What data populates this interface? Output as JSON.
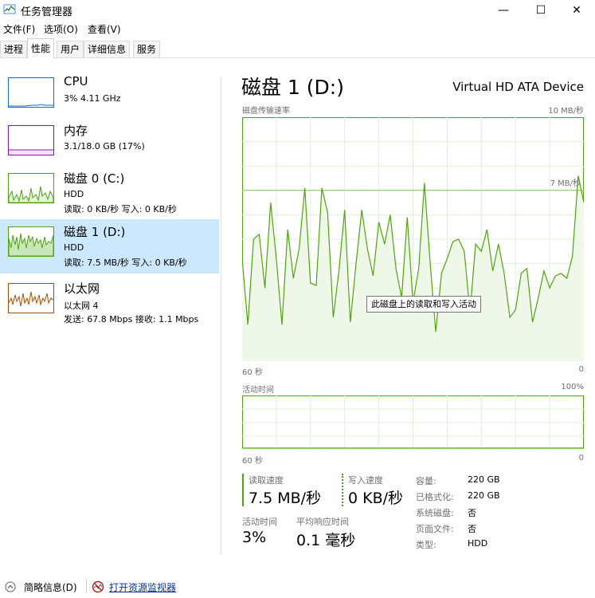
{
  "window": {
    "title": "任务管理器",
    "min_glyph": "—",
    "max_glyph": "☐",
    "close_glyph": "✕"
  },
  "menu": [
    "文件(F)",
    "选项(O)",
    "查看(V)"
  ],
  "tabs": [
    "进程",
    "性能",
    "用户",
    "详细信息",
    "服务"
  ],
  "active_tab": 1,
  "sidebar": [
    {
      "title": "CPU",
      "line2": "3% 4.11 GHz",
      "line3": "",
      "color": "#1171b8"
    },
    {
      "title": "内存",
      "line2": "3.1/18.0 GB (17%)",
      "line3": "",
      "color": "#8b12ae"
    },
    {
      "title": "磁盘 0 (C:)",
      "line2": "HDD",
      "line3": "读取: 0 KB/秒 写入: 0 KB/秒",
      "color": "#4da60c"
    },
    {
      "title": "磁盘 1 (D:)",
      "line2": "HDD",
      "line3": "读取: 7.5 MB/秒 写入: 0 KB/秒",
      "color": "#4da60c"
    },
    {
      "title": "以太网",
      "line2": "以太网 4",
      "line3": "发送: 67.8 Mbps 接收: 1.1 Mbps",
      "color": "#a74f01"
    }
  ],
  "active_sidebar": 3,
  "main": {
    "title": "磁盘 1 (D:)",
    "device": "Virtual HD ATA Device",
    "transfer_label": "磁盘传输速率",
    "transfer_max": "10 MB/秒",
    "transfer_mid": "7 MB/秒",
    "time_left": "60 秒",
    "time_right": "0",
    "active_label": "活动时间",
    "active_max": "100%",
    "tooltip": "此磁盘上的读取和写入活动"
  },
  "stats": {
    "read_label": "读取速度",
    "read_value": "7.5 MB/秒",
    "write_label": "写入速度",
    "write_value": "0 KB/秒",
    "active_label": "活动时间",
    "active_value": "3%",
    "resp_label": "平均响应时间",
    "resp_value": "0.1 毫秒"
  },
  "info": [
    {
      "label": "容量:",
      "value": "220 GB"
    },
    {
      "label": "已格式化:",
      "value": "220 GB"
    },
    {
      "label": "系统磁盘:",
      "value": "否"
    },
    {
      "label": "页面文件:",
      "value": "否"
    },
    {
      "label": "类型:",
      "value": "HDD"
    }
  ],
  "footer": {
    "summary": "简略信息(D)",
    "monitor": "打开资源监视器"
  },
  "chart_data": [
    {
      "type": "line",
      "title": "磁盘传输速率",
      "x_label_left": "60 秒",
      "x_label_right": "0",
      "ylim": [
        0,
        10
      ],
      "y_unit": "MB/秒",
      "mid_line": 7,
      "grid": true,
      "color": "#4da60c",
      "values": [
        4.2,
        1.5,
        5.0,
        5.2,
        3.0,
        6.5,
        4.2,
        1.5,
        5.4,
        3.4,
        4.6,
        7.1,
        3.2,
        3.1,
        7.1,
        6.1,
        1.8,
        3.7,
        6.2,
        1.6,
        4.0,
        6.2,
        4.6,
        3.5,
        5.7,
        4.8,
        6.0,
        3.8,
        2.6,
        5.9,
        2.4,
        3.8,
        7.3,
        4.1,
        1.2,
        3.6,
        4.2,
        4.9,
        5.0,
        4.5,
        2.0,
        4.8,
        4.5,
        5.4,
        3.7,
        4.8,
        3.6,
        1.8,
        2.1,
        3.6,
        3.8,
        1.6,
        2.6,
        3.7,
        3.0,
        3.5,
        3.6,
        3.4,
        4.3,
        7.6,
        6.5
      ]
    },
    {
      "type": "line",
      "title": "活动时间",
      "x_label_left": "60 秒",
      "x_label_right": "0",
      "ylim": [
        0,
        100
      ],
      "y_unit": "%",
      "grid": true,
      "color": "#4da60c",
      "values": [
        3,
        3,
        3,
        3,
        3,
        3,
        3,
        3,
        3,
        3,
        3,
        3,
        3,
        3,
        3,
        3,
        3,
        3,
        3,
        3,
        3,
        3,
        3,
        3,
        3,
        3,
        3,
        3,
        3,
        3,
        3,
        3,
        3,
        3,
        3,
        3,
        3,
        3,
        3,
        3,
        3,
        3,
        3,
        3,
        3,
        3,
        3,
        3,
        3,
        3,
        3,
        3,
        3,
        3,
        3,
        3,
        3,
        3,
        3,
        3,
        3
      ]
    }
  ]
}
